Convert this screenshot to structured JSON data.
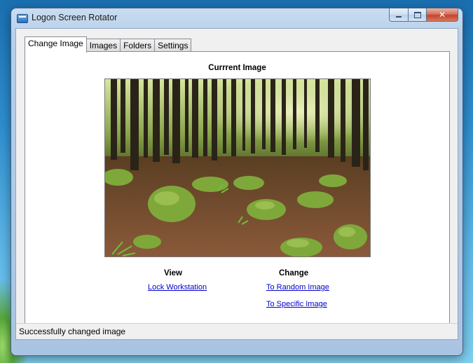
{
  "window": {
    "title": "Logon Screen Rotator",
    "controls": {
      "minimize": "minimize",
      "maximize": "maximize",
      "close": "✕"
    }
  },
  "tabs": [
    {
      "label": "Change Image",
      "active": true
    },
    {
      "label": "Images",
      "active": false
    },
    {
      "label": "Folders",
      "active": false
    },
    {
      "label": "Settings",
      "active": false
    }
  ],
  "current_image": {
    "heading": "Currrent Image"
  },
  "view": {
    "heading": "View",
    "lock_link": "Lock Workstation"
  },
  "change": {
    "heading": "Change",
    "random_link": "To Random Image",
    "specific_link": "To Specific Image"
  },
  "status": {
    "text": "Successfully changed image"
  },
  "colors": {
    "link": "#0000cc",
    "close_button": "#c6432c",
    "forest_floor": "#6b4a2e",
    "moss": "#7fa83a"
  }
}
